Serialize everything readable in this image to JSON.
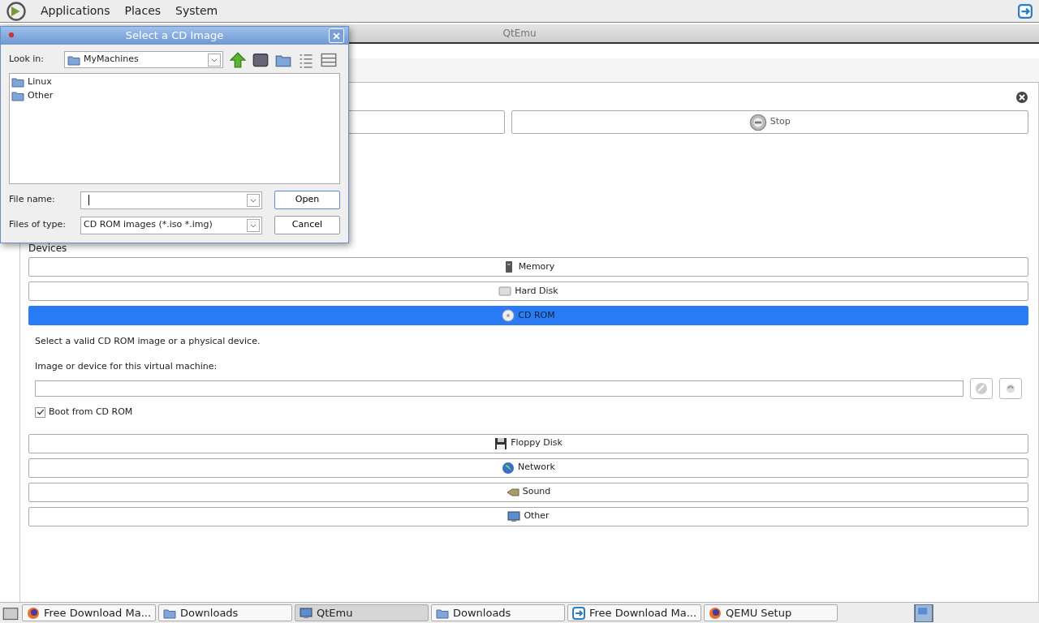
{
  "top_panel": {
    "menus": [
      "Applications",
      "Places",
      "System"
    ]
  },
  "window": {
    "title": "QtEmu"
  },
  "machine_panel": {
    "stop_button": "Stop",
    "devices_label": "Devices",
    "devices": [
      {
        "label": "Memory",
        "kind": "memory",
        "selected": false
      },
      {
        "label": "Hard Disk",
        "kind": "disk",
        "selected": false
      },
      {
        "label": "CD ROM",
        "kind": "cd",
        "selected": true
      },
      {
        "label": "Floppy Disk",
        "kind": "floppy",
        "selected": false
      },
      {
        "label": "Network",
        "kind": "globe",
        "selected": false
      },
      {
        "label": "Sound",
        "kind": "sound",
        "selected": false
      },
      {
        "label": "Other",
        "kind": "screen",
        "selected": false
      }
    ],
    "cd_page": {
      "hint": "Select a valid CD ROM image or a physical device.",
      "field_label": "Image or device for this virtual machine:",
      "boot_label": "Boot from CD ROM",
      "boot_checked": true
    }
  },
  "dialog": {
    "title": "Select a CD Image",
    "look_in_label": "Look in:",
    "look_in_value": "MyMachines",
    "files": [
      "Linux",
      "Other"
    ],
    "file_name_label": "File name:",
    "file_type_label": "Files of type:",
    "file_type_value": "CD ROM images (*.iso *.img)",
    "buttons": [
      "Open",
      "Cancel"
    ]
  },
  "taskbar": [
    {
      "label": "Free Download Ma...",
      "kind": "fox",
      "selected": false
    },
    {
      "label": "Downloads",
      "kind": "folder",
      "selected": false
    },
    {
      "label": "QtEmu",
      "kind": "screen",
      "selected": true
    },
    {
      "label": "Downloads",
      "kind": "folder",
      "selected": false
    },
    {
      "label": "Free Download Ma...",
      "kind": "arrows",
      "selected": false
    },
    {
      "label": "QEMU Setup",
      "kind": "fox",
      "selected": false
    }
  ]
}
